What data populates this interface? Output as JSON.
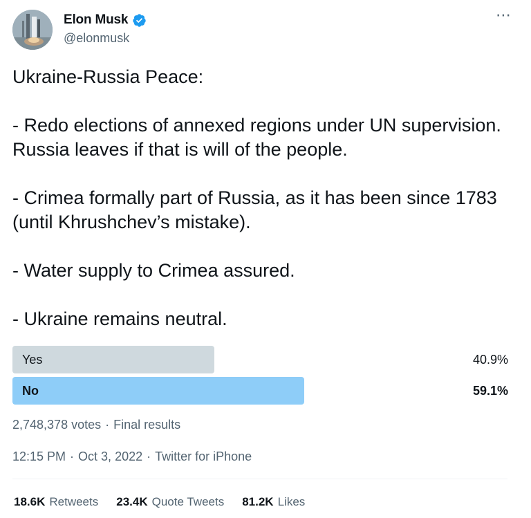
{
  "author": {
    "display_name": "Elon Musk",
    "handle": "@elonmusk",
    "verified": true,
    "avatar_icon": "rocket-launch-photo"
  },
  "more_icon": "⋯",
  "tweet": {
    "lines": [
      "Ukraine-Russia Peace:",
      "",
      "- Redo elections of annexed regions under UN supervision. Russia leaves if that is will of the people.",
      "",
      "- Crimea formally part of Russia, as it has been since 1783 (until Khrushchev’s mistake).",
      "",
      "- Water supply to Crimea assured.",
      "",
      "- Ukraine remains neutral."
    ]
  },
  "poll": {
    "options": [
      {
        "label": "Yes",
        "percent_text": "40.9%",
        "percent": 40.9,
        "winner": false,
        "bar_color": "#cfd9de"
      },
      {
        "label": "No",
        "percent_text": "59.1%",
        "percent": 59.1,
        "winner": true,
        "bar_color": "#8ecdf8"
      }
    ],
    "votes": "2,748,378 votes",
    "status": "Final results"
  },
  "timestamp": {
    "time": "12:15 PM",
    "date": "Oct 3, 2022",
    "source": "Twitter for iPhone"
  },
  "stats": [
    {
      "count": "18.6K",
      "label": "Retweets"
    },
    {
      "count": "23.4K",
      "label": "Quote Tweets"
    },
    {
      "count": "81.2K",
      "label": "Likes"
    }
  ],
  "colors": {
    "text": "#0f1419",
    "secondary": "#536471",
    "verified": "#1d9bf0"
  }
}
